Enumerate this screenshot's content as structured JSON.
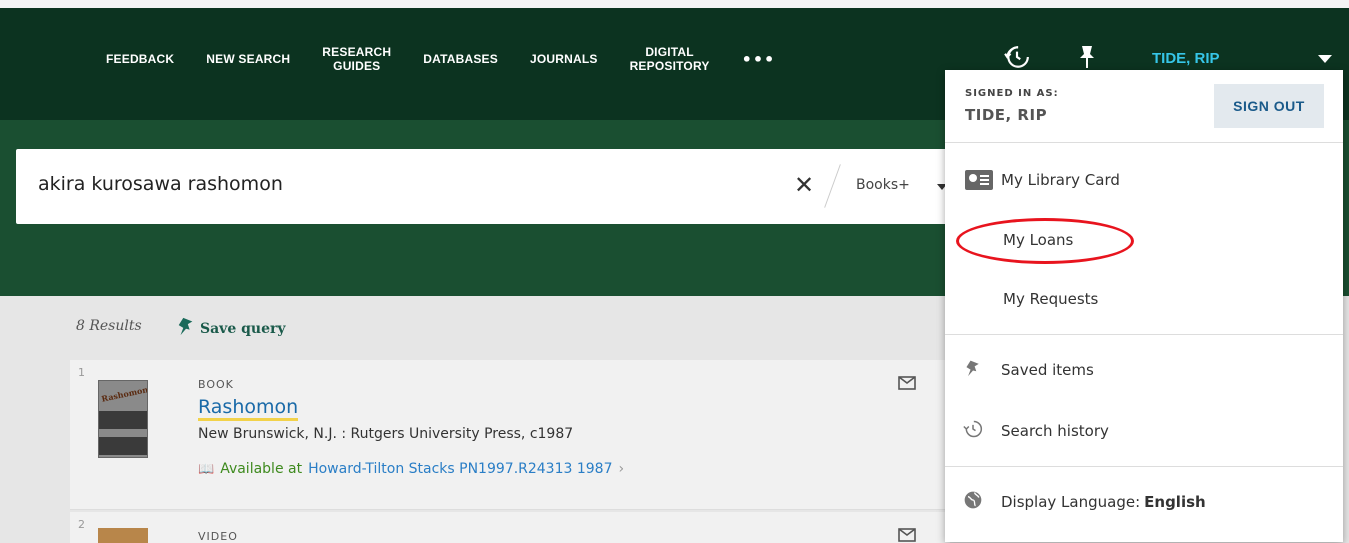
{
  "nav": {
    "items": [
      {
        "label": "FEEDBACK"
      },
      {
        "label": "NEW SEARCH"
      },
      {
        "label": "RESEARCH\nGUIDES"
      },
      {
        "label": "DATABASES"
      },
      {
        "label": "JOURNALS"
      },
      {
        "label": "DIGITAL\nREPOSITORY"
      }
    ],
    "more": "•••"
  },
  "header": {
    "history_icon": "history-icon",
    "pin_icon": "pin-icon",
    "user_name": "TIDE, RIP"
  },
  "search": {
    "query": "akira kurosawa rashomon",
    "clear_icon": "close-icon",
    "scope": "Books+"
  },
  "results": {
    "count_label": "8 Results",
    "save_query": "Save query",
    "items": [
      {
        "number": "1",
        "type": "BOOK",
        "title": "Rashomon",
        "publication": "New Brunswick, N.J. : Rutgers University Press, c1987",
        "availability": "Available at",
        "location": "Howard-Tilton Stacks PN1997.R24313 1987",
        "thumb_text": "Rashomon"
      },
      {
        "number": "2",
        "type": "VIDEO"
      }
    ]
  },
  "user_menu": {
    "signed_in_label": "SIGNED IN AS:",
    "user_name": "TIDE, RIP",
    "sign_out": "SIGN OUT",
    "items": {
      "library_card": "My Library Card",
      "loans": "My Loans",
      "requests": "My Requests",
      "saved_items": "Saved items",
      "search_history": "Search history",
      "display_language_label": "Display Language:",
      "display_language_value": "English"
    }
  },
  "colors": {
    "topbar": "#0c3320",
    "band": "#1a4f31",
    "user_accent": "#36c6e8",
    "link": "#1a6aa8",
    "available": "#3e8a1e",
    "highlight": "#e8141e"
  }
}
